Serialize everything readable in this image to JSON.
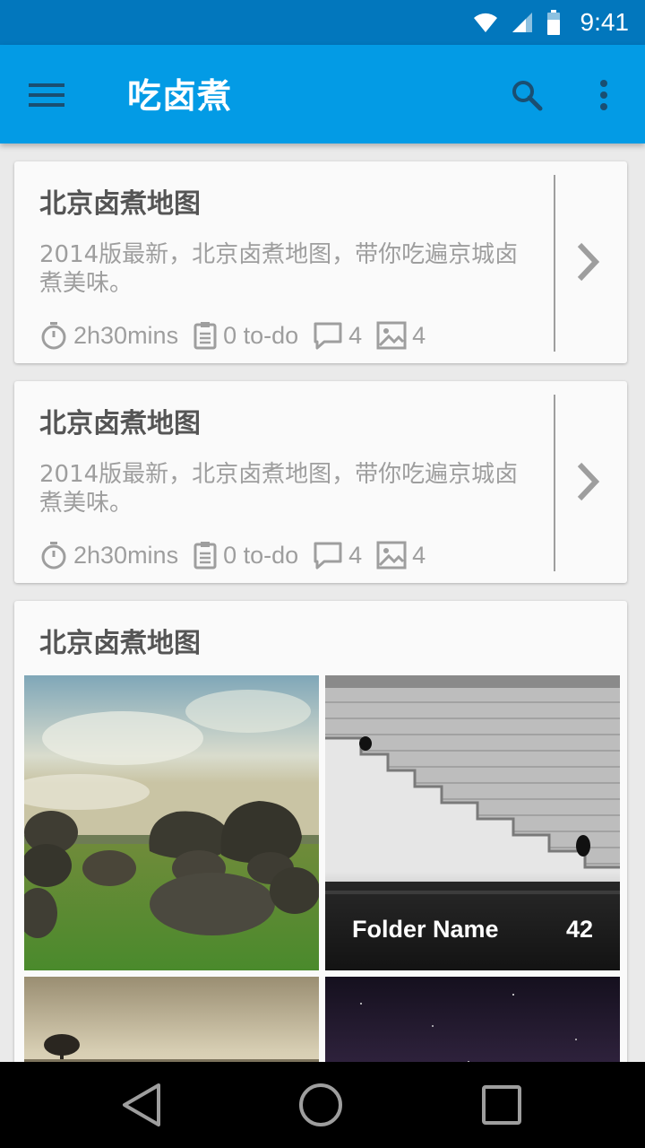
{
  "status_bar": {
    "time": "9:41"
  },
  "app_bar": {
    "title": "吃卤煮"
  },
  "cards": [
    {
      "title": "北京卤煮地图",
      "description": "2014版最新，北京卤煮地图，带你吃遍京城卤煮美味。",
      "duration": "2h30mins",
      "todo": "0 to-do",
      "comments": "4",
      "images": "4"
    },
    {
      "title": "北京卤煮地图",
      "description": "2014版最新，北京卤煮地图，带你吃遍京城卤煮美味。",
      "duration": "2h30mins",
      "todo": "0 to-do",
      "comments": "4",
      "images": "4"
    }
  ],
  "gallery": {
    "title": "北京卤煮地图",
    "folder": {
      "name": "Folder Name",
      "count": "42"
    }
  },
  "colors": {
    "status_bar": "#0277bd",
    "app_bar": "#039be5",
    "background": "#eaeaea",
    "card": "#fafafa",
    "meta_text": "#9e9e9e"
  },
  "icons": [
    "menu-icon",
    "search-icon",
    "more-vert-icon",
    "timer-icon",
    "clipboard-icon",
    "comment-icon",
    "image-icon",
    "chevron-right-icon",
    "back-icon",
    "home-icon",
    "recents-icon"
  ]
}
